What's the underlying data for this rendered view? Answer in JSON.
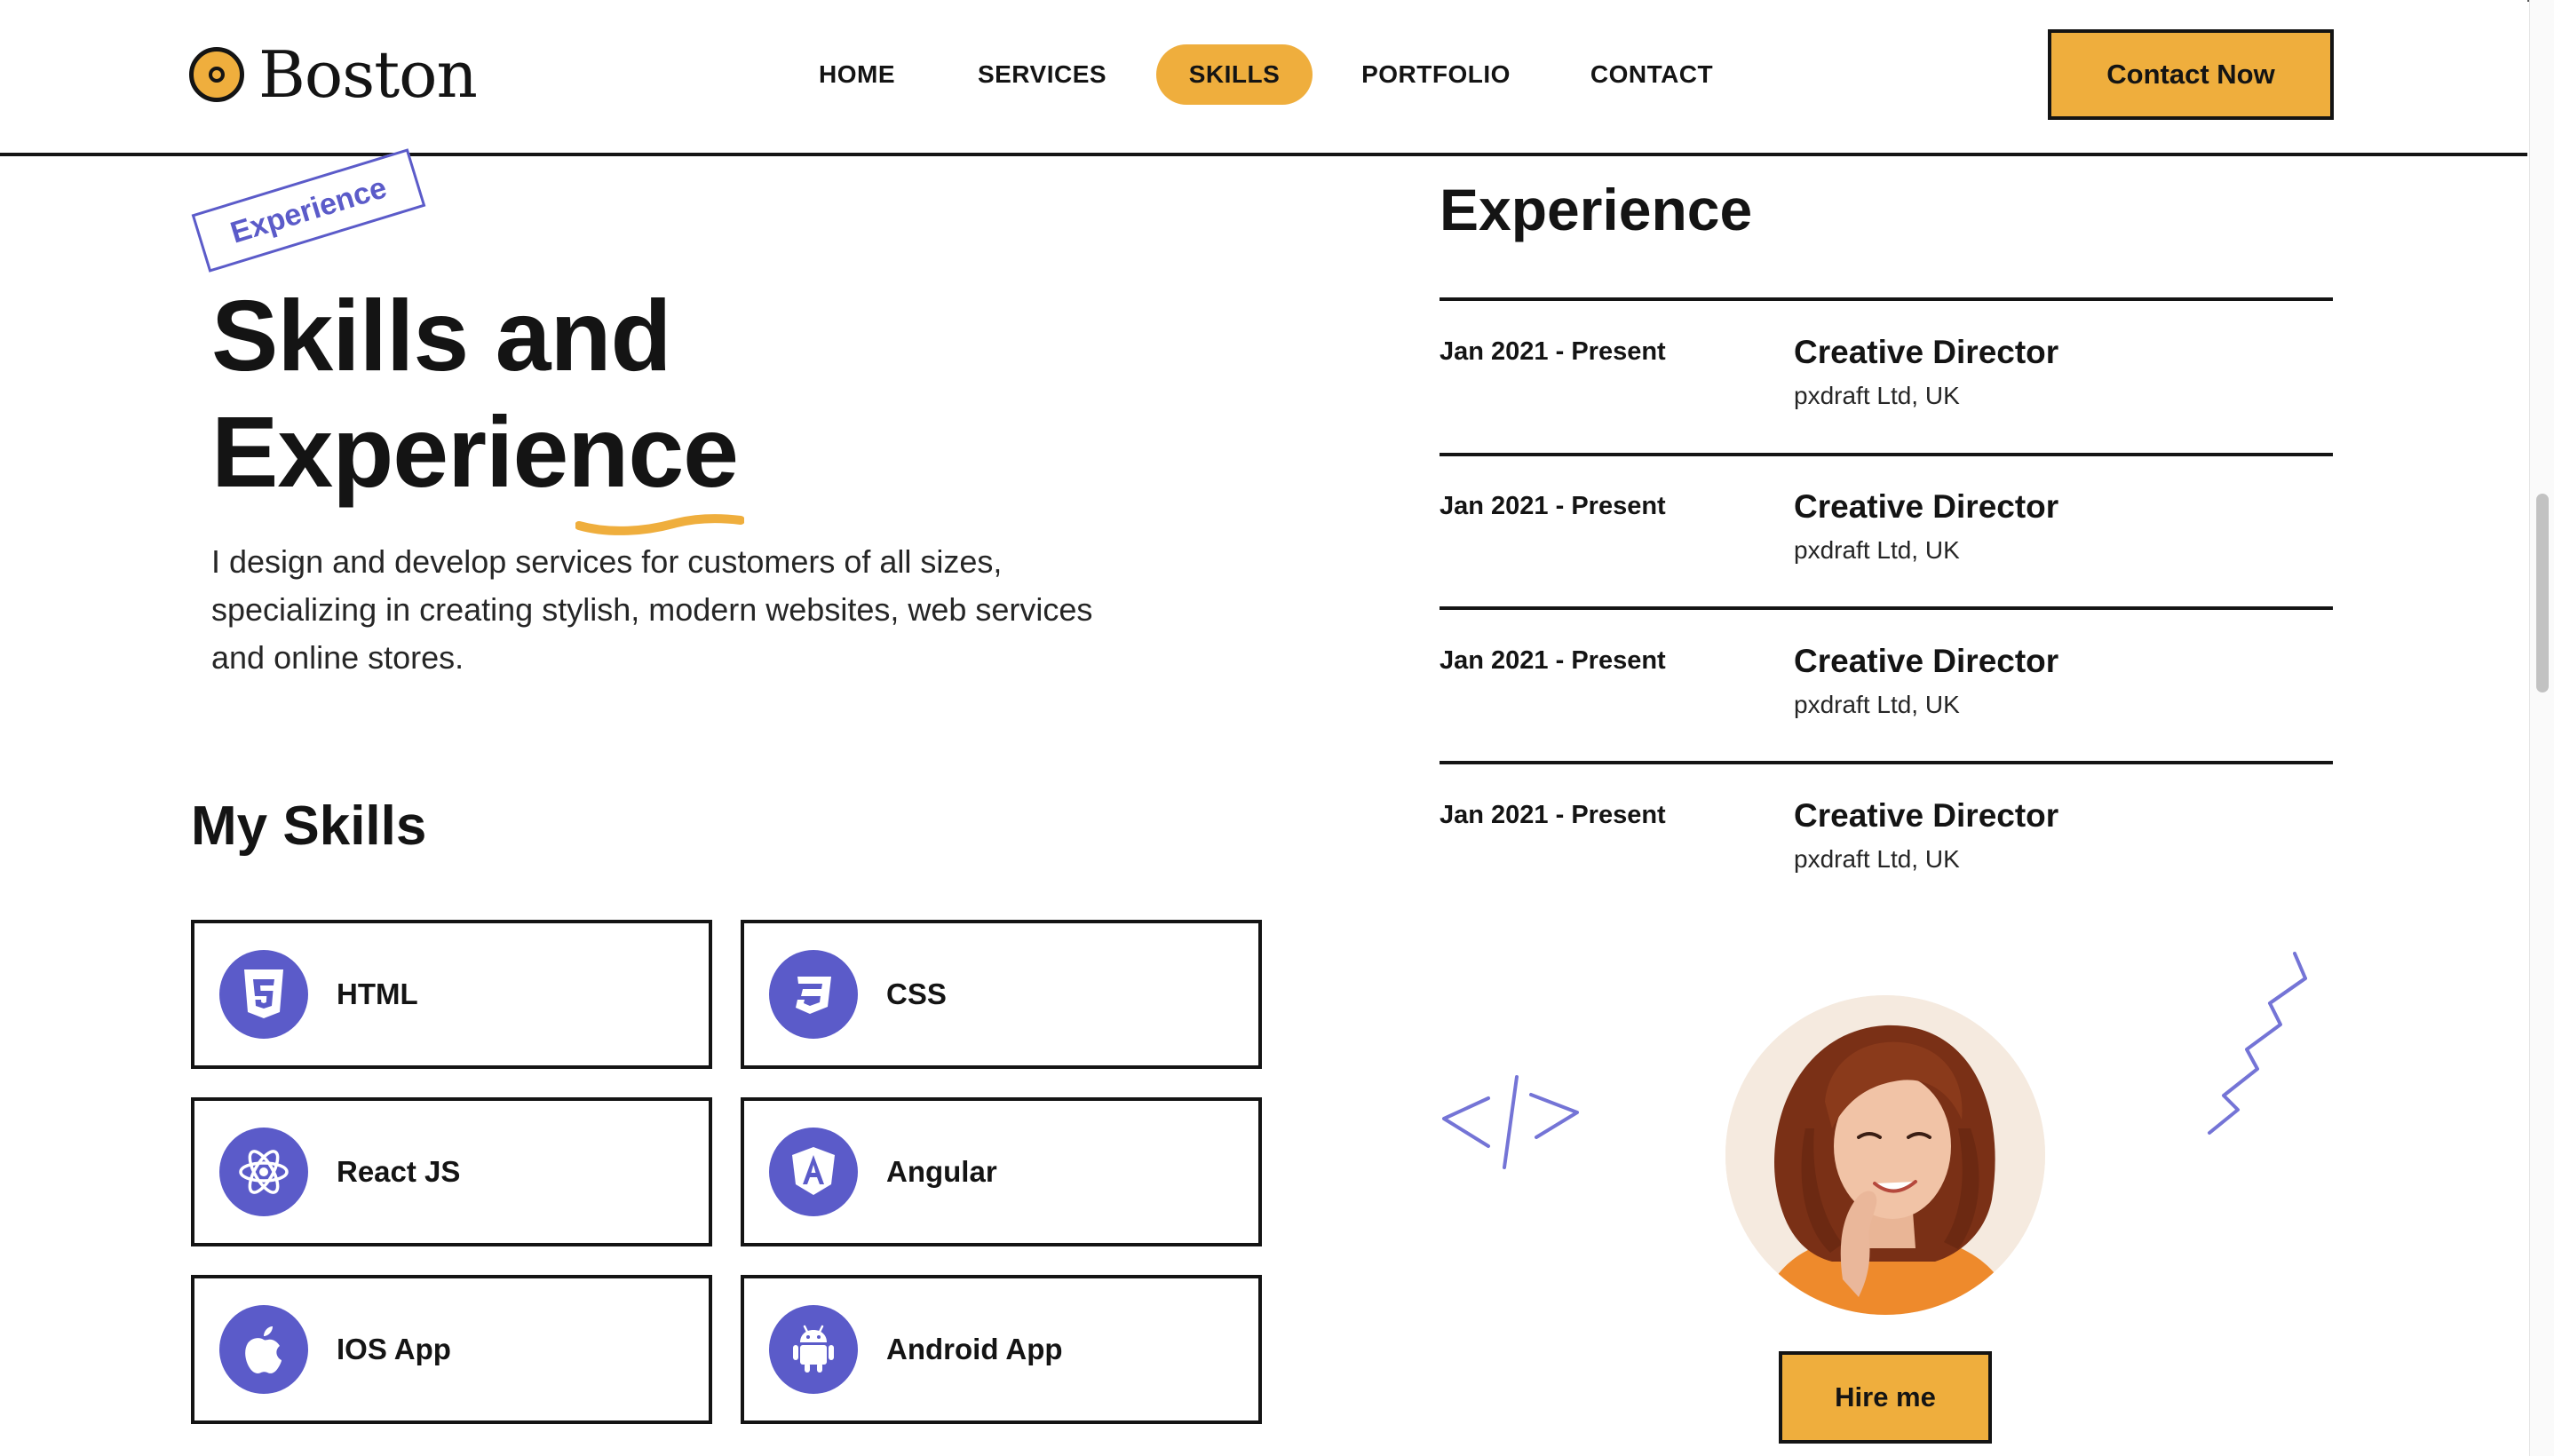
{
  "header": {
    "logo_text": "Boston",
    "nav": [
      {
        "label": "HOME",
        "active": false
      },
      {
        "label": "SERVICES",
        "active": false
      },
      {
        "label": "SKILLS",
        "active": true
      },
      {
        "label": "PORTFOLIO",
        "active": false
      },
      {
        "label": "CONTACT",
        "active": false
      }
    ],
    "contact_button": "Contact Now"
  },
  "hero": {
    "stamp": "Experience",
    "title_line1": "Skills and",
    "title_line2": "Experience",
    "description": "I design and develop services for customers of all sizes, specializing in creating stylish, modern websites, web services and online stores."
  },
  "skills": {
    "title": "My Skills",
    "items": [
      {
        "label": "HTML",
        "icon": "html5-icon"
      },
      {
        "label": "CSS",
        "icon": "css3-icon"
      },
      {
        "label": "React JS",
        "icon": "react-icon"
      },
      {
        "label": "Angular",
        "icon": "angular-icon"
      },
      {
        "label": "IOS App",
        "icon": "apple-icon"
      },
      {
        "label": "Android App",
        "icon": "android-icon"
      }
    ]
  },
  "experience": {
    "title": "Experience",
    "items": [
      {
        "date": "Jan 2021 - Present",
        "role": "Creative Director",
        "company": "pxdraft Ltd, UK"
      },
      {
        "date": "Jan 2021 - Present",
        "role": "Creative Director",
        "company": "pxdraft Ltd, UK"
      },
      {
        "date": "Jan 2021 - Present",
        "role": "Creative Director",
        "company": "pxdraft Ltd, UK"
      },
      {
        "date": "Jan 2021 - Present",
        "role": "Creative Director",
        "company": "pxdraft Ltd, UK"
      }
    ]
  },
  "hire_button": "Hire me",
  "colors": {
    "accent": "#efae3d",
    "icon_bg": "#5b5bc9",
    "text": "#141414"
  }
}
